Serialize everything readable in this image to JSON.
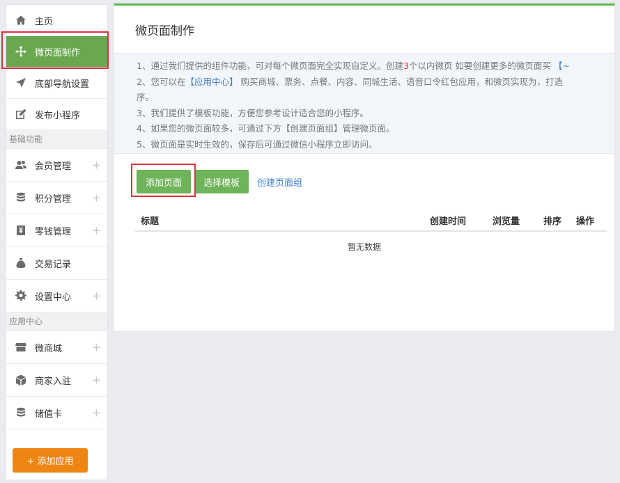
{
  "sidebar": {
    "top_items": [
      {
        "label": "主页",
        "icon": "home-icon"
      },
      {
        "label": "微页面制作",
        "icon": "move-icon",
        "active": true
      },
      {
        "label": "底部导航设置",
        "icon": "navigation-arrow-icon"
      },
      {
        "label": "发布小程序",
        "icon": "edit-icon"
      }
    ],
    "section_basic": "基础功能",
    "basic_items": [
      {
        "label": "会员管理",
        "icon": "users-icon",
        "expand": "+"
      },
      {
        "label": "积分管理",
        "icon": "coins-icon",
        "expand": "+"
      },
      {
        "label": "零钱管理",
        "icon": "yen-icon",
        "expand": "+"
      },
      {
        "label": "交易记录",
        "icon": "money-bag-icon"
      },
      {
        "label": "设置中心",
        "icon": "gear-icon",
        "expand": "+"
      }
    ],
    "section_apps": "应用中心",
    "app_items": [
      {
        "label": "微商城",
        "icon": "store-icon",
        "expand": "+"
      },
      {
        "label": "商家入驻",
        "icon": "box-icon",
        "expand": "+"
      },
      {
        "label": "储值卡",
        "icon": "database-icon",
        "expand": "+"
      }
    ],
    "add_app_label": "+ 添加应用"
  },
  "main": {
    "title": "微页面制作",
    "notice": {
      "line1_a": "1、通过我们提供的组件功能，可对每个微页面完全实现自定义。创建",
      "line1_num": "3",
      "line1_b": "个以内微页  如要创建更多的微页面买",
      "line1_link": "【~",
      "line2_a": "2、您可以在",
      "line2_link": "【应用中心】",
      "line2_b": "购买商城、票务、点餐、内容、同城生活、语音口令红包应用，和微页实现为，打造",
      "line2_c": "序。",
      "line3": "3、我们提供了模板功能，方便您参考设计适合您的小程序。",
      "line4": "4、如果您的微页面较多，可通过下方【创建页面组】管理微页面。",
      "line5": "5、微页面是实时生效的，保存后可通过微信小程序立即访问。"
    },
    "buttons": {
      "add_page": "添加页面",
      "choose_template": "选择模板",
      "create_group": "创建页面组"
    },
    "table": {
      "columns": [
        "标题",
        "创建时间",
        "浏览量",
        "排序",
        "操作"
      ],
      "empty_text": "暂无数据"
    }
  },
  "colors": {
    "accent_green": "#6aa84f",
    "highlight_red": "#e0313b",
    "orange": "#ef8614",
    "link_blue": "#3b7ec9"
  }
}
